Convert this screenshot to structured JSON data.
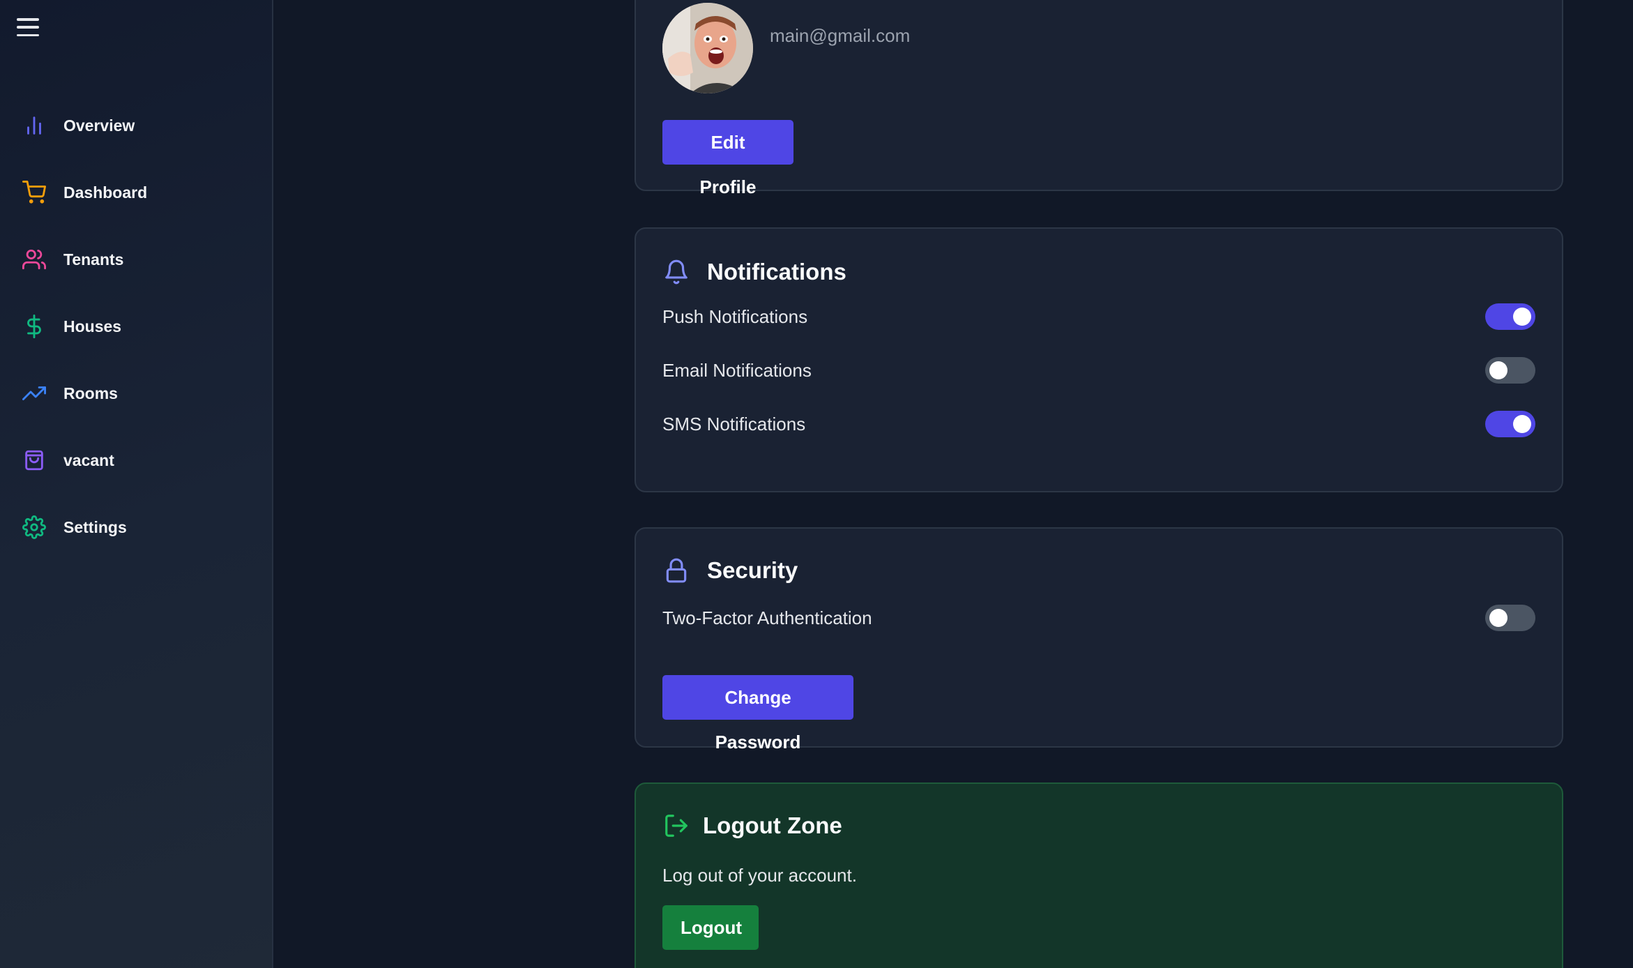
{
  "sidebar": {
    "items": [
      {
        "label": "Overview",
        "icon": "bar-chart-icon",
        "color": "#6366f1"
      },
      {
        "label": "Dashboard",
        "icon": "shopping-cart-icon",
        "color": "#f59e0b"
      },
      {
        "label": "Tenants",
        "icon": "users-icon",
        "color": "#ec4899"
      },
      {
        "label": "Houses",
        "icon": "dollar-sign-icon",
        "color": "#10b981"
      },
      {
        "label": "Rooms",
        "icon": "trending-up-icon",
        "color": "#3b82f6"
      },
      {
        "label": "vacant",
        "icon": "shopping-bag-icon",
        "color": "#8b5cf6"
      },
      {
        "label": "Settings",
        "icon": "gear-icon",
        "color": "#10b981"
      }
    ]
  },
  "profile": {
    "email": "main@gmail.com",
    "edit_label": "Edit Profile"
  },
  "notifications": {
    "title": "Notifications",
    "settings": [
      {
        "label": "Push Notifications",
        "enabled": true
      },
      {
        "label": "Email Notifications",
        "enabled": false
      },
      {
        "label": "SMS Notifications",
        "enabled": true
      }
    ]
  },
  "security": {
    "title": "Security",
    "two_factor_label": "Two-Factor Authentication",
    "two_factor_enabled": false,
    "change_password_label": "Change Password"
  },
  "logout": {
    "title": "Logout Zone",
    "description": "Log out of your account.",
    "button_label": "Logout"
  },
  "colors": {
    "accent": "#4f46e5",
    "logout_green": "#15803d",
    "background": "#111827"
  }
}
